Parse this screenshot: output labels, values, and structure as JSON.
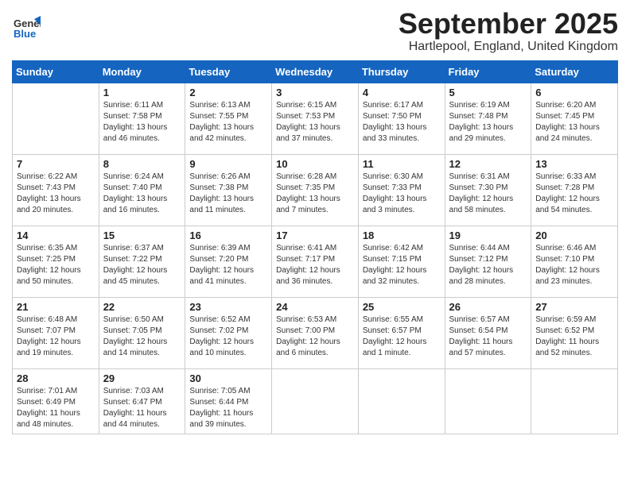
{
  "logo": {
    "general": "General",
    "blue": "Blue"
  },
  "header": {
    "month": "September 2025",
    "location": "Hartlepool, England, United Kingdom"
  },
  "weekdays": [
    "Sunday",
    "Monday",
    "Tuesday",
    "Wednesday",
    "Thursday",
    "Friday",
    "Saturday"
  ],
  "weeks": [
    [
      {
        "day": "",
        "info": ""
      },
      {
        "day": "1",
        "info": "Sunrise: 6:11 AM\nSunset: 7:58 PM\nDaylight: 13 hours and 46 minutes."
      },
      {
        "day": "2",
        "info": "Sunrise: 6:13 AM\nSunset: 7:55 PM\nDaylight: 13 hours and 42 minutes."
      },
      {
        "day": "3",
        "info": "Sunrise: 6:15 AM\nSunset: 7:53 PM\nDaylight: 13 hours and 37 minutes."
      },
      {
        "day": "4",
        "info": "Sunrise: 6:17 AM\nSunset: 7:50 PM\nDaylight: 13 hours and 33 minutes."
      },
      {
        "day": "5",
        "info": "Sunrise: 6:19 AM\nSunset: 7:48 PM\nDaylight: 13 hours and 29 minutes."
      },
      {
        "day": "6",
        "info": "Sunrise: 6:20 AM\nSunset: 7:45 PM\nDaylight: 13 hours and 24 minutes."
      }
    ],
    [
      {
        "day": "7",
        "info": "Sunrise: 6:22 AM\nSunset: 7:43 PM\nDaylight: 13 hours and 20 minutes."
      },
      {
        "day": "8",
        "info": "Sunrise: 6:24 AM\nSunset: 7:40 PM\nDaylight: 13 hours and 16 minutes."
      },
      {
        "day": "9",
        "info": "Sunrise: 6:26 AM\nSunset: 7:38 PM\nDaylight: 13 hours and 11 minutes."
      },
      {
        "day": "10",
        "info": "Sunrise: 6:28 AM\nSunset: 7:35 PM\nDaylight: 13 hours and 7 minutes."
      },
      {
        "day": "11",
        "info": "Sunrise: 6:30 AM\nSunset: 7:33 PM\nDaylight: 13 hours and 3 minutes."
      },
      {
        "day": "12",
        "info": "Sunrise: 6:31 AM\nSunset: 7:30 PM\nDaylight: 12 hours and 58 minutes."
      },
      {
        "day": "13",
        "info": "Sunrise: 6:33 AM\nSunset: 7:28 PM\nDaylight: 12 hours and 54 minutes."
      }
    ],
    [
      {
        "day": "14",
        "info": "Sunrise: 6:35 AM\nSunset: 7:25 PM\nDaylight: 12 hours and 50 minutes."
      },
      {
        "day": "15",
        "info": "Sunrise: 6:37 AM\nSunset: 7:22 PM\nDaylight: 12 hours and 45 minutes."
      },
      {
        "day": "16",
        "info": "Sunrise: 6:39 AM\nSunset: 7:20 PM\nDaylight: 12 hours and 41 minutes."
      },
      {
        "day": "17",
        "info": "Sunrise: 6:41 AM\nSunset: 7:17 PM\nDaylight: 12 hours and 36 minutes."
      },
      {
        "day": "18",
        "info": "Sunrise: 6:42 AM\nSunset: 7:15 PM\nDaylight: 12 hours and 32 minutes."
      },
      {
        "day": "19",
        "info": "Sunrise: 6:44 AM\nSunset: 7:12 PM\nDaylight: 12 hours and 28 minutes."
      },
      {
        "day": "20",
        "info": "Sunrise: 6:46 AM\nSunset: 7:10 PM\nDaylight: 12 hours and 23 minutes."
      }
    ],
    [
      {
        "day": "21",
        "info": "Sunrise: 6:48 AM\nSunset: 7:07 PM\nDaylight: 12 hours and 19 minutes."
      },
      {
        "day": "22",
        "info": "Sunrise: 6:50 AM\nSunset: 7:05 PM\nDaylight: 12 hours and 14 minutes."
      },
      {
        "day": "23",
        "info": "Sunrise: 6:52 AM\nSunset: 7:02 PM\nDaylight: 12 hours and 10 minutes."
      },
      {
        "day": "24",
        "info": "Sunrise: 6:53 AM\nSunset: 7:00 PM\nDaylight: 12 hours and 6 minutes."
      },
      {
        "day": "25",
        "info": "Sunrise: 6:55 AM\nSunset: 6:57 PM\nDaylight: 12 hours and 1 minute."
      },
      {
        "day": "26",
        "info": "Sunrise: 6:57 AM\nSunset: 6:54 PM\nDaylight: 11 hours and 57 minutes."
      },
      {
        "day": "27",
        "info": "Sunrise: 6:59 AM\nSunset: 6:52 PM\nDaylight: 11 hours and 52 minutes."
      }
    ],
    [
      {
        "day": "28",
        "info": "Sunrise: 7:01 AM\nSunset: 6:49 PM\nDaylight: 11 hours and 48 minutes."
      },
      {
        "day": "29",
        "info": "Sunrise: 7:03 AM\nSunset: 6:47 PM\nDaylight: 11 hours and 44 minutes."
      },
      {
        "day": "30",
        "info": "Sunrise: 7:05 AM\nSunset: 6:44 PM\nDaylight: 11 hours and 39 minutes."
      },
      {
        "day": "",
        "info": ""
      },
      {
        "day": "",
        "info": ""
      },
      {
        "day": "",
        "info": ""
      },
      {
        "day": "",
        "info": ""
      }
    ]
  ]
}
